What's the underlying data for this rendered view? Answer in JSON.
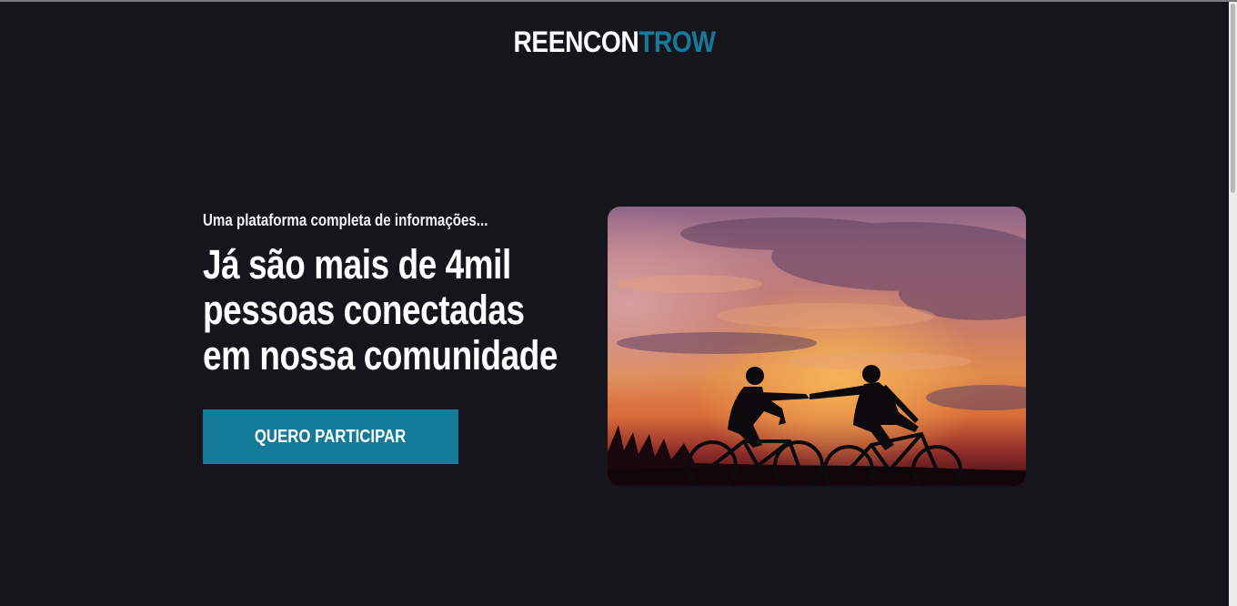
{
  "header": {
    "logo_part1": "REENCON",
    "logo_part2": "TROW",
    "logo_accent_color": "#167b9b"
  },
  "hero": {
    "subtitle": "Uma plataforma completa de informações...",
    "headline_lines": [
      "Já são mais de 4mil",
      "pessoas conectadas",
      "em nossa comunidade"
    ],
    "cta_label": "QUERO PARTICIPAR",
    "cta_color": "#137a99",
    "image_description_icon": "couple-cycling-sunset-photo"
  },
  "theme": {
    "background": "#16151b"
  }
}
